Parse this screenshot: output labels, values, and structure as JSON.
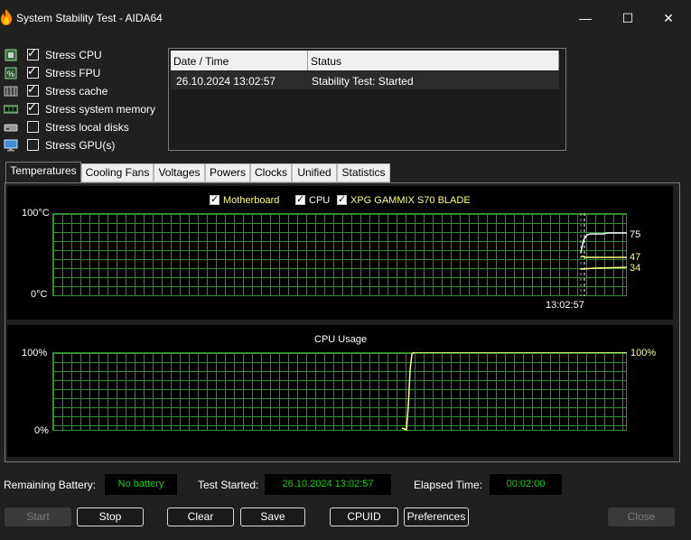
{
  "window": {
    "title": "System Stability Test - AIDA64",
    "minimize_glyph": "—",
    "maximize_glyph": "☐",
    "close_glyph": "✕"
  },
  "stress_options": [
    {
      "label": "Stress CPU",
      "checked": true,
      "icon": "cpu-chip-icon"
    },
    {
      "label": "Stress FPU",
      "checked": true,
      "icon": "fpu-icon"
    },
    {
      "label": "Stress cache",
      "checked": true,
      "icon": "cache-icon"
    },
    {
      "label": "Stress system memory",
      "checked": true,
      "icon": "memory-icon"
    },
    {
      "label": "Stress local disks",
      "checked": false,
      "icon": "disk-icon"
    },
    {
      "label": "Stress GPU(s)",
      "checked": false,
      "icon": "monitor-icon"
    }
  ],
  "log": {
    "headers": [
      "Date / Time",
      "Status"
    ],
    "rows": [
      {
        "datetime": "26.10.2024 13:02:57",
        "status": "Stability Test: Started"
      }
    ]
  },
  "tabs": [
    "Temperatures",
    "Cooling Fans",
    "Voltages",
    "Powers",
    "Clocks",
    "Unified",
    "Statistics"
  ],
  "active_tab": "Temperatures",
  "temperature_graph": {
    "legend": [
      {
        "label": "Motherboard",
        "color": "#ffff80",
        "checked": true
      },
      {
        "label": "CPU",
        "color": "#ffffff",
        "checked": true
      },
      {
        "label": "XPG GAMMIX S70 BLADE",
        "color": "#ffff80",
        "checked": true
      }
    ],
    "y_max_label": "100°C",
    "y_min_label": "0°C",
    "time_label": "13:02:57",
    "value_labels": [
      "75",
      "47",
      "34"
    ]
  },
  "cpu_graph": {
    "title": "CPU Usage",
    "y_max_label": "100%",
    "y_min_label": "0%",
    "value_label": "100%"
  },
  "chart_data": [
    {
      "type": "line",
      "title": "",
      "ylim": [
        0,
        100
      ],
      "x": [
        "13:02:57"
      ],
      "series": [
        {
          "name": "CPU",
          "current": 75
        },
        {
          "name": "Motherboard",
          "current": 47
        },
        {
          "name": "XPG GAMMIX S70 BLADE",
          "current": 34
        }
      ]
    },
    {
      "type": "line",
      "title": "CPU Usage",
      "ylim": [
        0,
        100
      ],
      "series": [
        {
          "current": 100
        }
      ]
    }
  ],
  "status_bar": {
    "battery_label": "Remaining Battery:",
    "battery_value": "No battery",
    "started_label": "Test Started:",
    "started_value": "26.10.2024 13:02:57",
    "elapsed_label": "Elapsed Time:",
    "elapsed_value": "00:02:00"
  },
  "buttons": {
    "start": "Start",
    "stop": "Stop",
    "clear": "Clear",
    "save": "Save",
    "cpuid": "CPUID",
    "preferences": "Preferences",
    "close": "Close"
  },
  "colors": {
    "background": "#202020",
    "grid": "#2f8f2f",
    "status_value": "#00d900",
    "yellow_series": "#ffff80"
  }
}
